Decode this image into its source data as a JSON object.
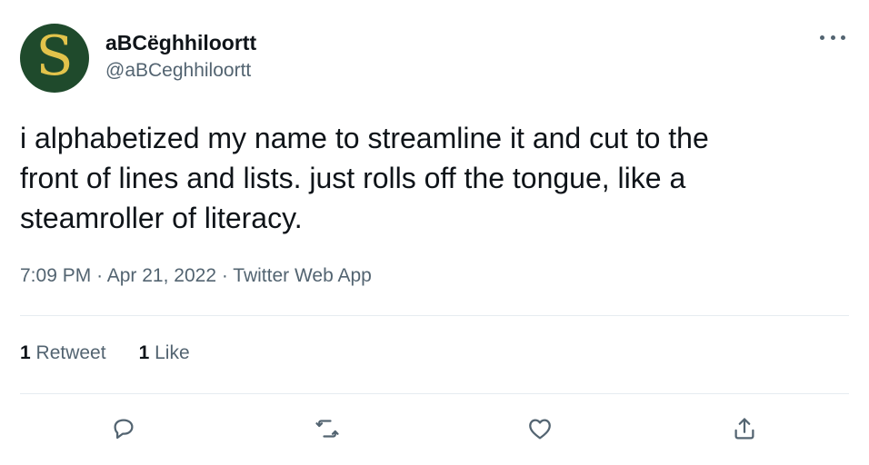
{
  "author": {
    "avatar_letter": "S",
    "display_name": "aBCëghhiloortt",
    "handle": "@aBCeghhiloortt"
  },
  "tweet": {
    "text": "i alphabetized my name to streamline it and cut to the\nfront of lines and lists. just rolls off the tongue, like a\nsteamroller of literacy.",
    "time": "7:09 PM",
    "date": "Apr 21, 2022",
    "source": "Twitter Web App",
    "separator": "·"
  },
  "stats": {
    "retweets_count": "1",
    "retweets_label": "Retweet",
    "likes_count": "1",
    "likes_label": "Like"
  },
  "icons": {
    "more": "more-horizontal-icon",
    "reply": "reply-icon",
    "retweet": "retweet-icon",
    "like": "heart-icon",
    "share": "share-icon"
  },
  "colors": {
    "avatar_bg": "#1f4a2c",
    "avatar_letter": "#e2c34b",
    "text": "#0f1419",
    "secondary": "#536471"
  }
}
